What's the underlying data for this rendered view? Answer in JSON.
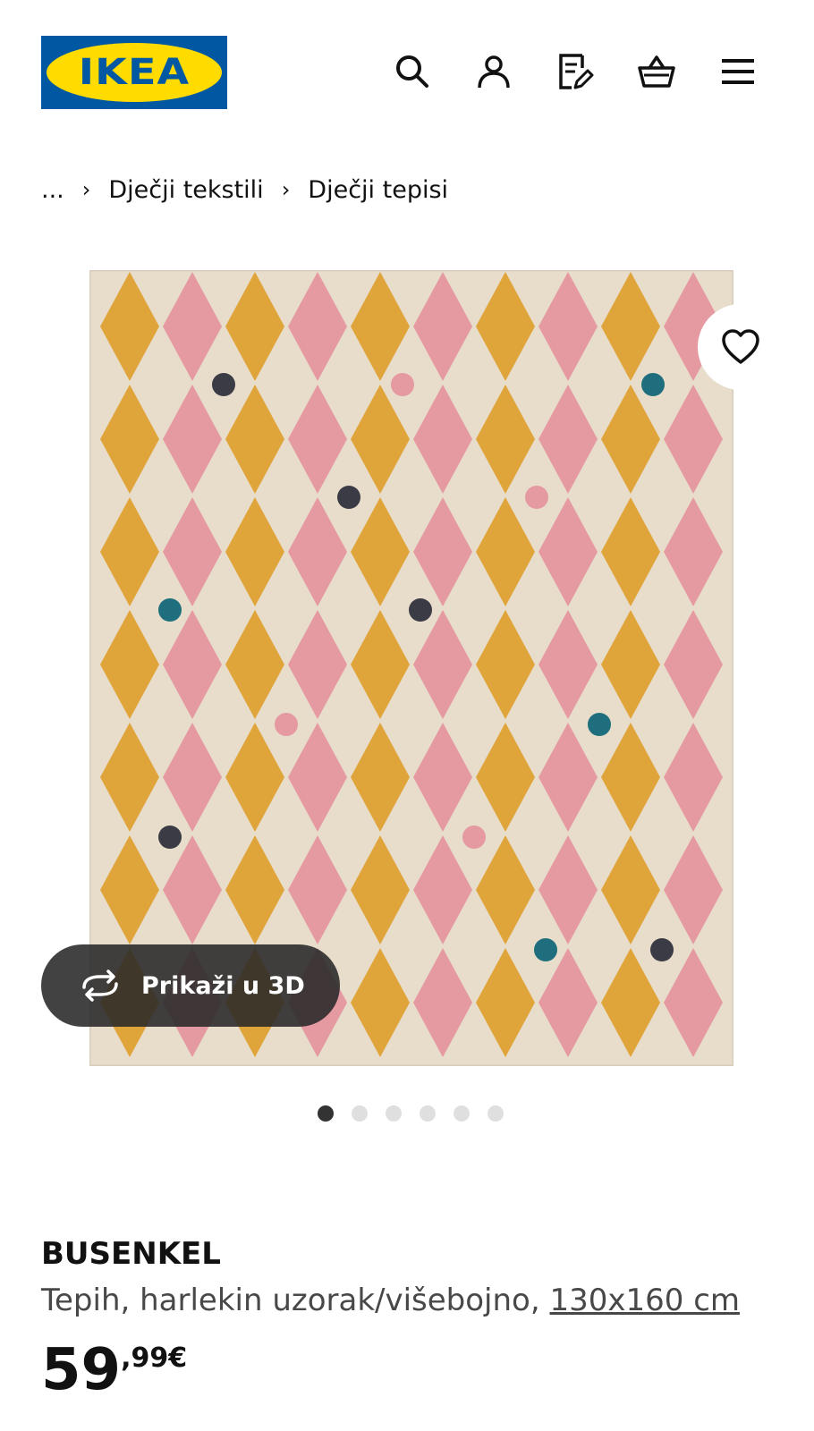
{
  "header": {
    "logo_text": "IKEA",
    "icons": [
      "search-icon",
      "user-icon",
      "shopping-list-icon",
      "basket-icon",
      "menu-icon"
    ]
  },
  "breadcrumb": {
    "ellipsis": "...",
    "items": [
      "Dječji tekstili",
      "Dječji tepisi"
    ]
  },
  "gallery": {
    "view_3d_label": "Prikaži u 3D",
    "image_count": 6,
    "active_index": 0
  },
  "product": {
    "name": "BUSENKEL",
    "description": "Tepih, harlekin uzorak/višebojno,",
    "size": "130x160 cm",
    "price_integer": "59",
    "price_decimal": ",99€"
  },
  "colors": {
    "ikea_blue": "#0058A3",
    "ikea_yellow": "#FFDB00",
    "rug_background": "#E8DCCB",
    "rug_palette": [
      "#E0A53A",
      "#3B3B45",
      "#C0312F",
      "#E59AA2",
      "#8FD6CC",
      "#1F6E7E"
    ]
  }
}
